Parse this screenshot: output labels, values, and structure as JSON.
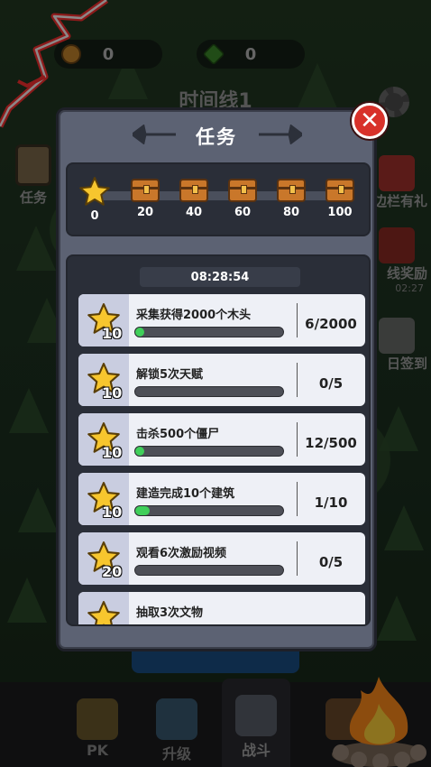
{
  "top_bar": {
    "coin_count": "0",
    "gem_count": "0"
  },
  "background": {
    "timeline_title": "时间线1",
    "left_side": [
      {
        "label": "任务",
        "icon": "clipboard-icon"
      }
    ],
    "right_side": [
      {
        "label": "边栏有礼",
        "icon": "gift-icon"
      },
      {
        "label": "线奖励",
        "sub": "02:27",
        "icon": "calendar-icon"
      },
      {
        "label": "日签到",
        "icon": "checkin-icon"
      }
    ]
  },
  "modal": {
    "title": "任务",
    "close_icon": "close-icon",
    "progress": {
      "milestones": [
        "0",
        "20",
        "40",
        "60",
        "80",
        "100"
      ],
      "current_fraction": 0
    },
    "timer": "08:28:54",
    "tasks": [
      {
        "name": "采集获得2000个木头",
        "reward": "10",
        "count": "6/2000",
        "progress": 0.003
      },
      {
        "name": "解锁5次天赋",
        "reward": "10",
        "count": "0/5",
        "progress": 0
      },
      {
        "name": "击杀500个僵尸",
        "reward": "10",
        "count": "12/500",
        "progress": 0.024
      },
      {
        "name": "建造完成10个建筑",
        "reward": "10",
        "count": "1/10",
        "progress": 0.1
      },
      {
        "name": "观看6次激励视频",
        "reward": "20",
        "count": "0/5",
        "progress": 0
      },
      {
        "name": "抽取3次文物",
        "reward": "",
        "count": "",
        "progress": 0
      }
    ]
  },
  "bottom_nav": [
    {
      "label": "PK",
      "icon": "shield-swords-icon"
    },
    {
      "label": "升级",
      "icon": "upgrade-arrows-icon"
    },
    {
      "label": "战斗",
      "icon": "crossed-axes-icon",
      "active": true
    }
  ],
  "colors": {
    "accent_green": "#3fcf5a",
    "close_red": "#d8312a",
    "modal_bg": "#5c6273",
    "panel_bg": "#2a2e38"
  }
}
